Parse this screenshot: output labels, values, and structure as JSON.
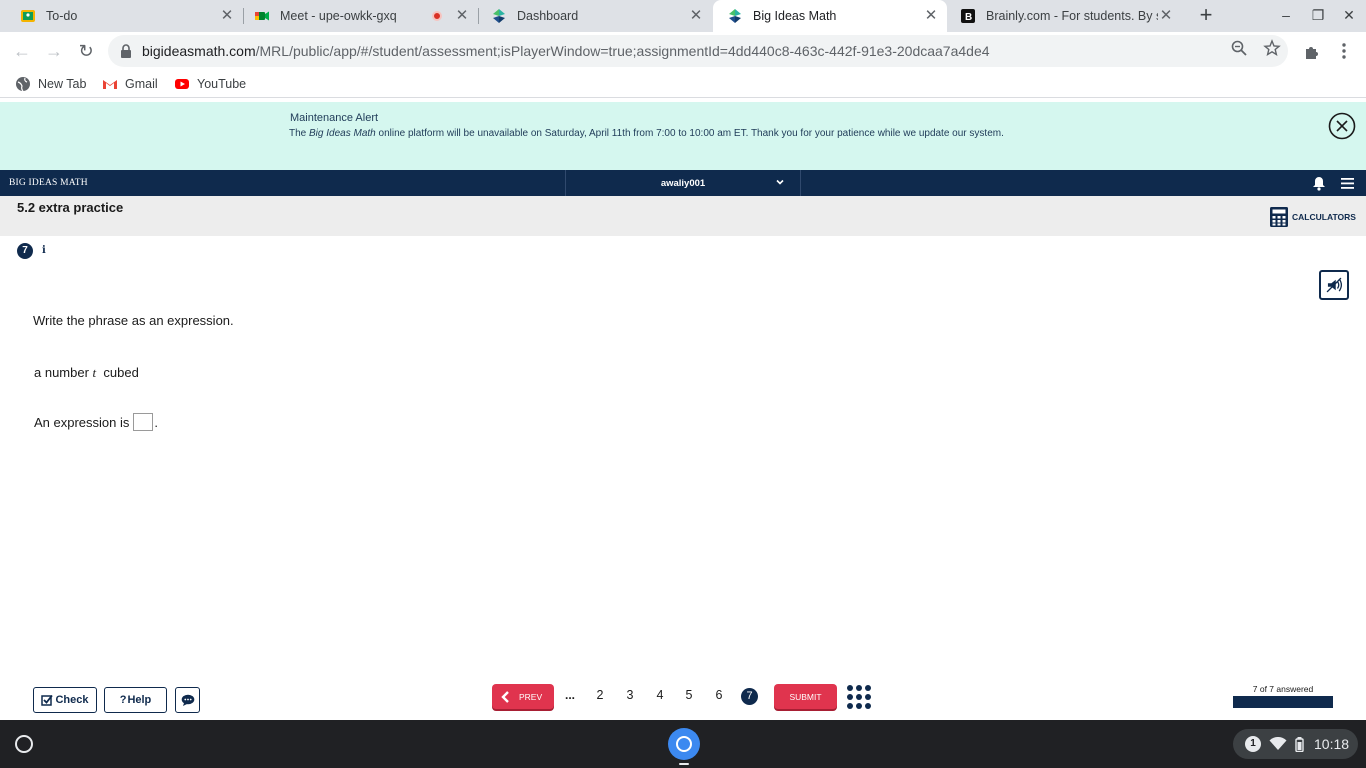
{
  "browser": {
    "tabs": [
      {
        "title": "To-do",
        "active": false
      },
      {
        "title": "Meet - upe-owkk-gxq",
        "active": false
      },
      {
        "title": "Dashboard",
        "active": false
      },
      {
        "title": "Big Ideas Math",
        "active": true
      },
      {
        "title": "Brainly.com - For students. By st",
        "active": false
      }
    ],
    "url_host": "bigideasmath.com",
    "url_path": "/MRL/public/app/#/student/assessment;isPlayerWindow=true;assignmentId=4dd440c8-463c-442f-91e3-20dcaa7a4de4",
    "bookmarks": [
      "New Tab",
      "Gmail",
      "YouTube"
    ]
  },
  "alert": {
    "title": "Maintenance Alert",
    "msg_prefix": "The ",
    "msg_brand": "Big Ideas Math",
    "msg_suffix": " online platform will be unavailable on Saturday, April 11th from 7:00 to 10:00 am ET. Thank you for your patience while we update our system."
  },
  "app": {
    "brand": "BIG IDEAS MATH",
    "username": "awaliy001",
    "assignment_title": "5.2 extra practice",
    "calculators_label": "CALCULATORS"
  },
  "question": {
    "number": "7",
    "info_label": "i",
    "prompt": "Write the phrase as an expression.",
    "phrase_prefix": "a number ",
    "phrase_var": "t",
    "phrase_suffix": "  cubed",
    "answer_label": "An expression is",
    "answer_value": "",
    "answer_end": "."
  },
  "footer": {
    "check_label": "Check",
    "help_label": "Help",
    "prev_label": "PREV",
    "ellipsis": "...",
    "pages": [
      "2",
      "3",
      "4",
      "5",
      "6"
    ],
    "current_page": "7",
    "submit_label": "SUBMIT",
    "progress_label": "7 of 7 answered",
    "progress_fraction": 1.0
  },
  "shelf": {
    "notification_count": "1",
    "time": "10:18"
  },
  "colors": {
    "navy": "#0f2a4d",
    "alert_bg": "#d5f7ef",
    "accent_red": "#e0344e"
  }
}
